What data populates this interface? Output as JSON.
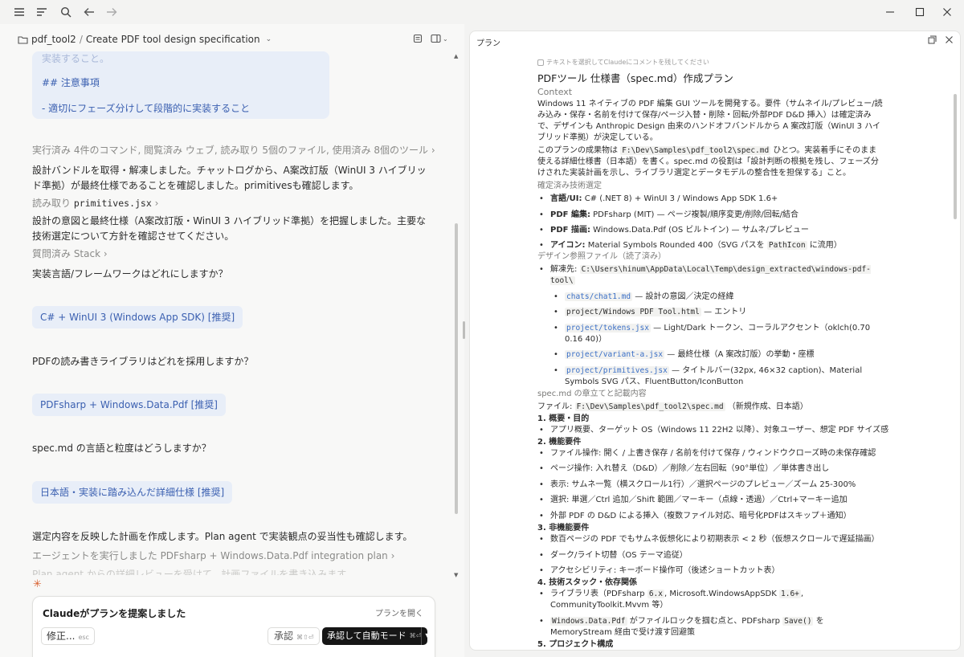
{
  "breadcrumb": {
    "project": "pdf_tool2",
    "separator": "/",
    "title": "Create PDF tool design specification"
  },
  "prev_message": {
    "ghost": "実装すること。",
    "heading": "## 注意事項",
    "item": "- 適切にフェーズ分けして段階的に実装すること"
  },
  "chat": {
    "activity": "実行済み 4件のコマンド, 閲覧済み ウェブ, 読み取り 5個のファイル, 使用済み 8個のツール",
    "para1": "設計バンドルを取得・解凍しました。チャットログから、A案改訂版（WinUI 3 ハイブリッド準拠）が最終仕様であることを確認しました。primitivesも確認します。",
    "read_label": "読み取り",
    "read_file": "primitives.jsx",
    "para2": "設計の意図と最終仕様（A案改訂版・WinUI 3 ハイブリッド準拠）を把握しました。主要な技術選定について方針を確認させてください。",
    "asked": "質問済み Stack",
    "q1": "実装言語/フレームワークはどれにしますか？",
    "a1": "C# + WinUI 3 (Windows App SDK) [推奨]",
    "q2": "PDFの読み書きライブラリはどれを採用しますか？",
    "a2": "PDFsharp + Windows.Data.Pdf [推奨]",
    "q3": "spec.md の言語と粒度はどうしますか？",
    "a3": "日本語・実装に踏み込んだ詳細仕様 [推奨]",
    "para3": "選定内容を反映した計画を作成します。Plan agent で実装観点の妥当性も確認します。",
    "agent": "エージェントを実行しました PDFsharp + Windows.Data.Pdf integration plan",
    "faded": "Plan agent からの詳細レビューを受けて、計画ファイルを書き込みます。"
  },
  "proposal_card": {
    "title": "Claudeがプランを提案しました",
    "open_plan": "プランを開く",
    "modify": "修正...",
    "modify_key": "esc",
    "approve": "承認",
    "approve_key": "⌘⇧⏎",
    "auto": "承認して自動モード",
    "auto_key": "⌘⏎"
  },
  "plan_panel": {
    "title": "プラン",
    "hint": "テキストを選択してClaudeにコメントを残してください",
    "doc_title": "PDFツール 仕様書（spec.md）作成プラン",
    "context_h": "Context",
    "ctx1": "Windows 11 ネイティブの PDF 編集 GUI ツールを開発する。要件（サムネイル/プレビュー/読み込み・保存・名前を付けて保存/ページ入替・削除・回転/外部PDF D&D 挿入）は確定済みで、デザインも Anthropic Design 由来のハンドオフバンドルから A 案改訂版（WinUI 3 ハイブリッド準拠）が決定している。",
    "ctx2a": "このプランの成果物は",
    "ctx2path": "F:\\Dev\\Samples\\pdf_tool2\\spec.md",
    "ctx2b": "ひとつ。実装着手にそのまま使える詳細仕様書（日本語）を書く。spec.md の役割は「設計判断の根拠を残し、フェーズ分けされた実装計画を示し、ライブラリ選定とデータモデルの整合性を担保する」こと。",
    "tech_h": "確定済み技術選定",
    "tech": [
      {
        "k": "言語/UI:",
        "v": "C# (.NET 8) + WinUI 3 / Windows App SDK 1.6+"
      },
      {
        "k": "PDF 編集:",
        "v": "PDFsharp (MIT) — ページ複製/順序変更/削除/回転/結合"
      },
      {
        "k": "PDF 描画:",
        "v": "Windows.Data.Pdf (OS ビルトイン) — サムネ/プレビュー"
      },
      {
        "k": "アイコン:",
        "v": "Material Symbols Rounded 400（SVG パスを",
        "code": "PathIcon",
        "v2": "に流用）"
      }
    ],
    "design_h": "デザイン参照ファイル（読了済み）",
    "extract_label": "解凍先:",
    "extract_path": "C:\\Users\\hinum\\AppData\\Local\\Temp\\design_extracted\\windows-pdf-tool\\",
    "files": [
      {
        "f": "chats/chat1.md",
        "d": "— 設計の意図／決定の経緯"
      },
      {
        "f": "project/Windows PDF Tool.html",
        "d": "— エントリ"
      },
      {
        "f": "project/tokens.jsx",
        "d": "— Light/Dark トークン、コーラルアクセント（oklch(0.70 0.16 40)）"
      },
      {
        "f": "project/variant-a.jsx",
        "d": "— 最終仕様（A 案改訂版）の挙動・座標"
      },
      {
        "f": "project/primitives.jsx",
        "d": "— タイトルバー(32px, 46×32 caption)、Material Symbols SVG パス、FluentButton/IconButton"
      }
    ],
    "chapters_h": "spec.md の章立てと記載内容",
    "file_line_a": "ファイル:",
    "file_line_path": "F:\\Dev\\Samples\\pdf_tool2\\spec.md",
    "file_line_b": "（新規作成、日本語）",
    "sec1": "1. 概要・目的",
    "sec1_items": [
      "アプリ概要、ターゲット OS（Windows 11 22H2 以降）、対象ユーザー、想定 PDF サイズ感"
    ],
    "sec2": "2. 機能要件",
    "sec2_items": [
      "ファイル操作: 開く / 上書き保存 / 名前を付けて保存 / ウィンドウクローズ時の未保存確認",
      "ページ操作: 入れ替え（D&D）／削除／左右回転（90°単位）／単体書き出し",
      "表示: サムネ一覧（横スクロール1行）／選択ページのプレビュー／ズーム 25-300%",
      "選択: 単選／Ctrl 追加／Shift 範囲／マーキー（点線・透過）／Ctrl+マーキー追加",
      "外部 PDF の D&D による挿入（複数ファイル対応、暗号化PDFはスキップ＋通知）"
    ],
    "sec3": "3. 非機能要件",
    "sec3_items": [
      "数百ページの PDF でもサムネ仮想化により初期表示 < 2 秒（仮想スクロールで遅延描画）",
      "ダーク/ライト切替（OS テーマ追従）",
      "アクセシビリティ: キーボード操作可（後述ショートカット表）"
    ],
    "sec4": "4. 技術スタック・依存関係",
    "sec4_item1a": "ライブラリ表（PDFsharp",
    "sec4_item1code": "6.x",
    "sec4_item1b": ", Microsoft.WindowsAppSDK",
    "sec4_item1code2": "1.6+",
    "sec4_item1c": ", CommunityToolkit.Mvvm 等）",
    "sec4_item2code": "Windows.Data.Pdf",
    "sec4_item2a": "がファイルロックを掴む点と、PDFsharp",
    "sec4_item2code2": "Save()",
    "sec4_item2b": "を MemoryStream 経由で受け渡す回避策",
    "sec5": "5. プロジェクト構成"
  }
}
